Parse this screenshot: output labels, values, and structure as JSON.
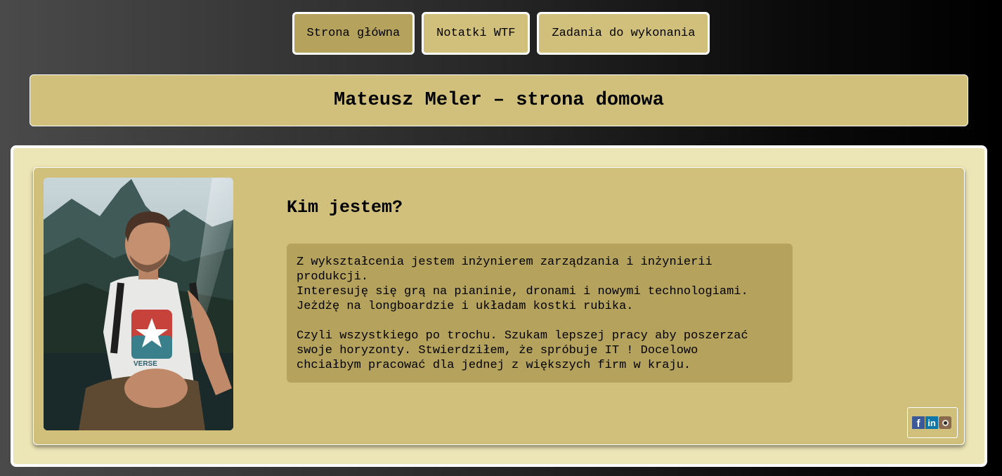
{
  "nav": {
    "items": [
      {
        "label": "Strona główna",
        "active": true
      },
      {
        "label": "Notatki WTF",
        "active": false
      },
      {
        "label": "Zadania do wykonania",
        "active": false
      }
    ]
  },
  "header": {
    "title": "Mateusz Meler – strona domowa"
  },
  "about": {
    "heading": "Kim jestem?",
    "paragraph1": "Z wykształcenia jestem inżynierem zarządzania i inżynierii\nprodukcji.\nInteresuję się grą na pianinie, dronami i nowymi technologiami.\nJeżdżę na longboardzie i układam kostki rubika.",
    "paragraph2": "Czyli wszystkiego po trochu. Szukam lepszej pracy aby poszerzać\nswoje horyzonty. Stwierdziłem, że spróbuje IT ! Docelowo\nchciałbym pracować dla jednej z większych firm w kraju.",
    "photo_icon": "profile-photo",
    "shirt_text": "VERSE"
  },
  "social": {
    "facebook": {
      "label": "f",
      "icon": "facebook-icon"
    },
    "linkedin": {
      "label": "in",
      "icon": "linkedin-icon"
    },
    "instagram": {
      "icon": "instagram-icon"
    }
  },
  "colors": {
    "nav_bg": "#d1c07c",
    "nav_active_bg": "#b4a25d",
    "panel_bg": "#ece5b5",
    "card_bg": "#d1c07c",
    "text_box_bg": "#b4a25d"
  }
}
